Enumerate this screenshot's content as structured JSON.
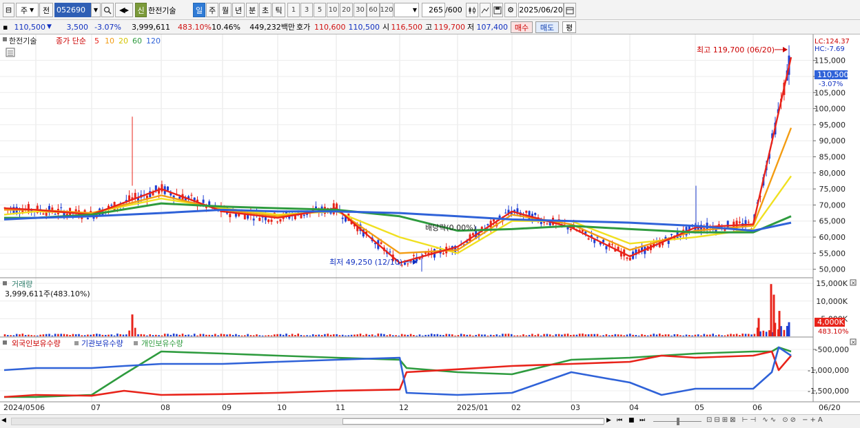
{
  "toolbar": {
    "market": "주",
    "prev": "전",
    "code": "052690",
    "new_badge": "신",
    "name": "한전기술",
    "periods": [
      "일",
      "주",
      "월",
      "년",
      "분",
      "초",
      "틱"
    ],
    "active_period": "일",
    "intervals": [
      "1",
      "3",
      "5",
      "10",
      "20",
      "30",
      "60",
      "120"
    ],
    "count": "265",
    "count_max": "/600",
    "date": "2025/06/20"
  },
  "quote": {
    "price": "110,500",
    "arrow": "▼",
    "change": "3,500",
    "change_pct": "-3.07%",
    "volume": "3,999,611",
    "volume_pct": "483.10%",
    "turnover_pct": "10.46%",
    "amount": "449,232백만",
    "hoga_label": "호가",
    "ask": "110,600",
    "bid": "110,500",
    "open_label": "시",
    "open": "116,500",
    "high_label": "고",
    "high": "119,700",
    "low_label": "저",
    "low": "107,400",
    "buy_label": "매수",
    "sell_label": "매도",
    "eval_label": "평"
  },
  "price_panel": {
    "stock_tag": "한전기술",
    "legend_title": "종가 단순",
    "ma_labels": [
      "5",
      "10",
      "20",
      "60",
      "120"
    ],
    "high_annotation": "최고 119,700 (06/20)",
    "low_annotation": "최저 49,250 (12/10)",
    "dividend_annotation": "배당락(0.00%)",
    "lc_label": "LC:124.37",
    "hc_label": "HC:-7.69",
    "current_tag": "110,500",
    "current_pct": "-3.07%",
    "y_ticks": [
      "115,000",
      "110,000",
      "105,000",
      "100,000",
      "95,000",
      "90,000",
      "85,000",
      "80,000",
      "75,000",
      "70,000",
      "65,000",
      "60,000",
      "55,000",
      "50,000"
    ]
  },
  "volume_panel": {
    "title": "거래량",
    "value_text": "3,999,611주(483.10%)",
    "y_ticks": [
      "15,000K",
      "10,000K",
      "5,000K"
    ],
    "current_tag": "4,000K",
    "current_pct": "483.10%"
  },
  "holding_panel": {
    "legend": [
      "외국인보유수량",
      "기관보유수량",
      "개인보유수량"
    ],
    "y_ticks": [
      "-500,000",
      "-1,000,000",
      "-1,500,000"
    ]
  },
  "x_axis": {
    "labels": [
      "2024/05",
      "06",
      "07",
      "08",
      "09",
      "10",
      "11",
      "12",
      "2025/01",
      "02",
      "03",
      "04",
      "05",
      "06"
    ],
    "right_label": "06/20"
  },
  "colors": {
    "candle_up": "#e8231a",
    "candle_down": "#1f3fd3",
    "ma5": "#e8231a",
    "ma10": "#f39c12",
    "ma20": "#f0e020",
    "ma60": "#2e9b3e",
    "ma120": "#2f62d8",
    "foreign": "#e8231a",
    "institution": "#2f62d8",
    "individual": "#2e9b3e"
  },
  "chart_data": {
    "type": "line",
    "title": "한전기술",
    "x": [
      "2024/05",
      "06",
      "07",
      "08",
      "09",
      "10",
      "11",
      "12",
      "2025/01",
      "02",
      "03",
      "04",
      "05",
      "06",
      "06/20"
    ],
    "series": [
      {
        "name": "5",
        "values": [
          69000,
          68500,
          67000,
          75000,
          68000,
          66000,
          69000,
          52000,
          57000,
          68000,
          63000,
          54000,
          63000,
          64000,
          116000
        ]
      },
      {
        "name": "10",
        "values": [
          68500,
          68500,
          67500,
          73000,
          68500,
          66500,
          68500,
          55000,
          56000,
          67000,
          64000,
          56000,
          62000,
          63500,
          94000
        ]
      },
      {
        "name": "20",
        "values": [
          67000,
          68000,
          67500,
          72000,
          69000,
          67000,
          68000,
          60000,
          55000,
          65000,
          65000,
          58000,
          60000,
          62500,
          79000
        ]
      },
      {
        "name": "60",
        "values": [
          66000,
          66000,
          67000,
          70500,
          69500,
          69000,
          68500,
          66500,
          62000,
          62500,
          63500,
          62500,
          61500,
          61500,
          66500
        ]
      },
      {
        "name": "120",
        "values": [
          65500,
          66000,
          66500,
          67500,
          68500,
          68000,
          68000,
          67500,
          66500,
          65500,
          65000,
          64500,
          63500,
          62000,
          64500
        ]
      }
    ],
    "high": {
      "value": 119700,
      "date": "06/20"
    },
    "low": {
      "value": 49250,
      "date": "12/10"
    },
    "ylim": [
      48000,
      122000
    ]
  }
}
